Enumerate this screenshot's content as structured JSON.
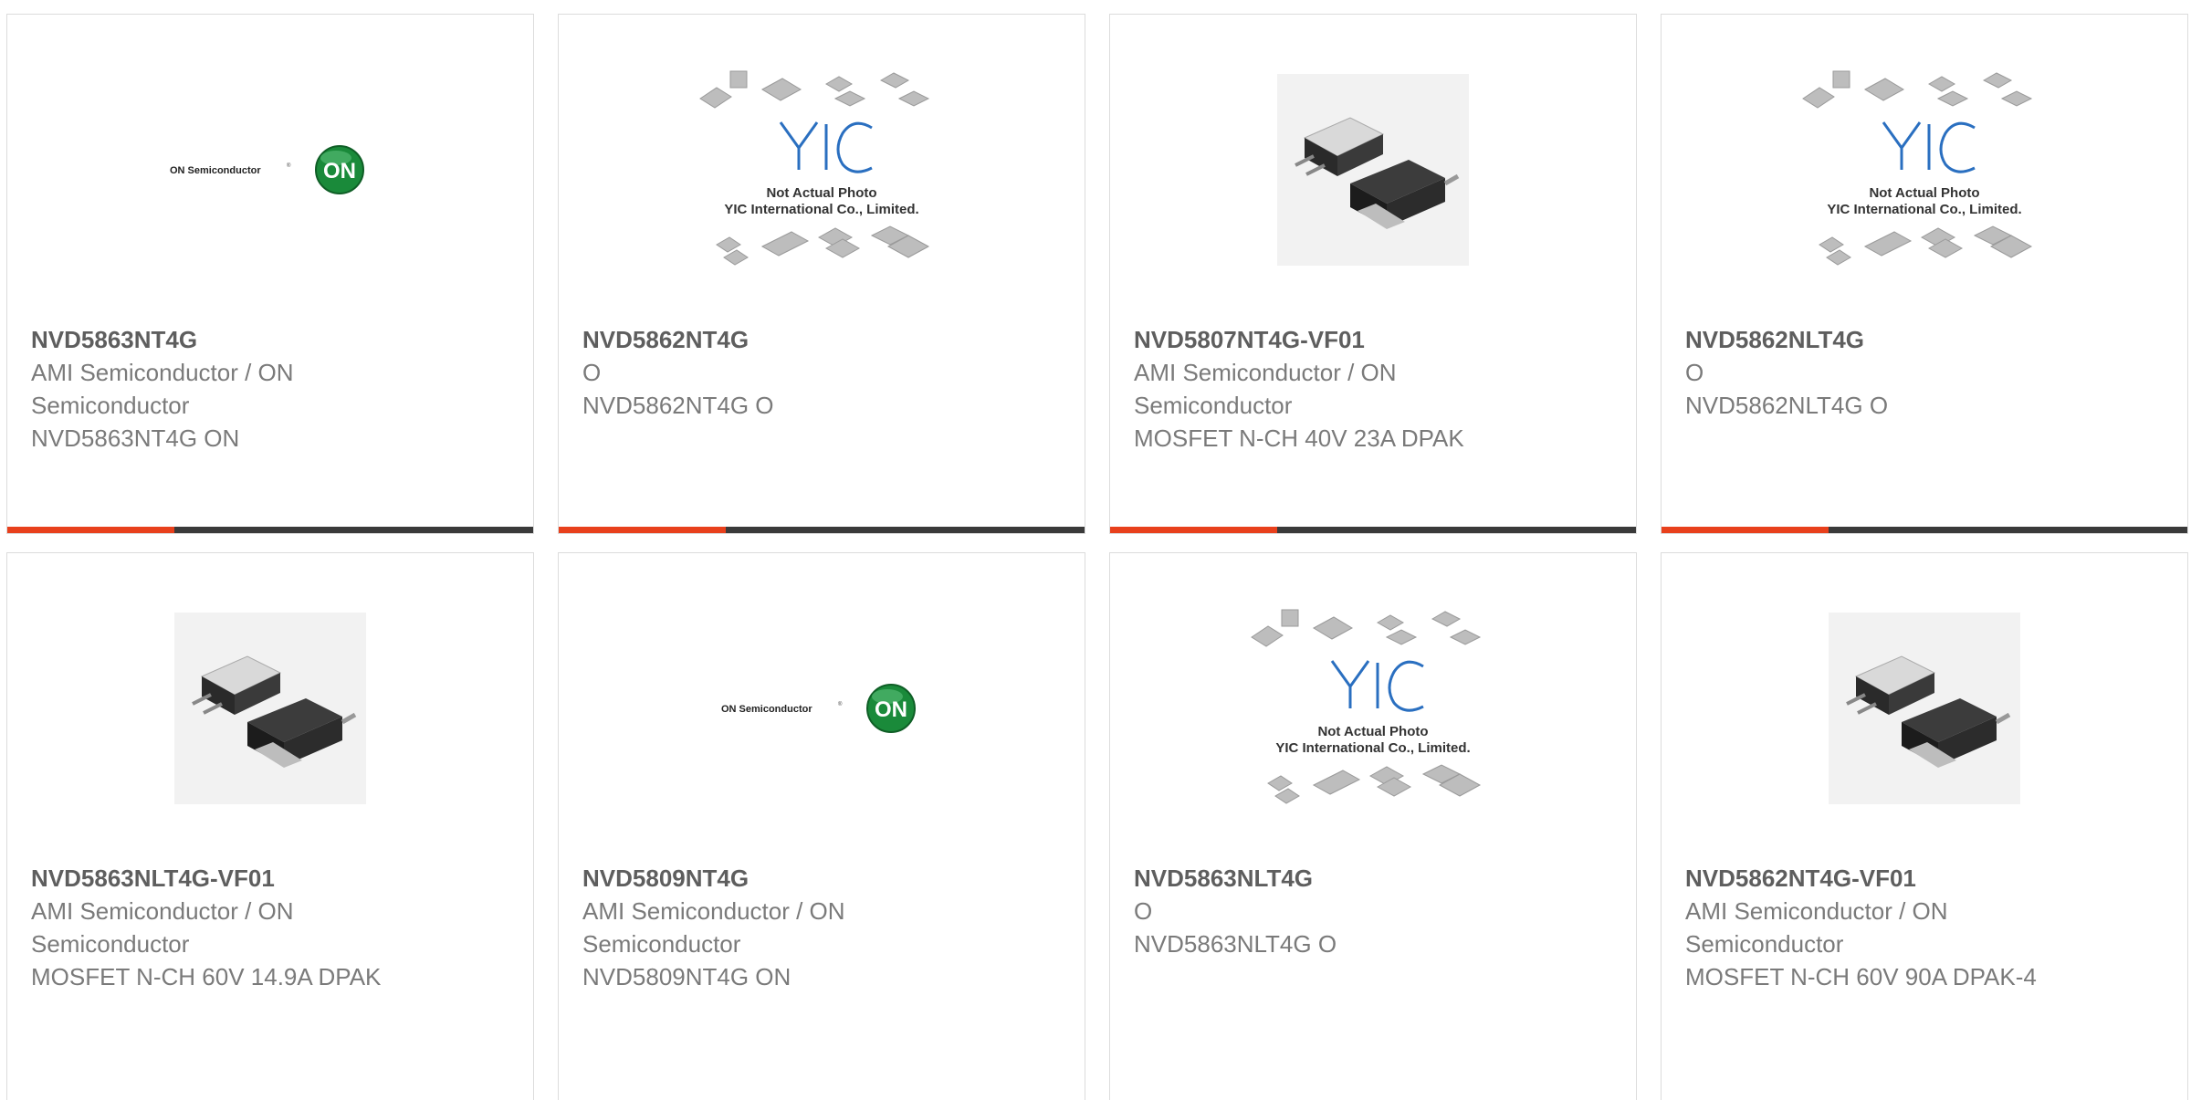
{
  "logos": {
    "on_semi_text": "ON Semiconductor",
    "on_badge": "ON",
    "yic_text": "YIC",
    "yic_caption_1": "Not Actual Photo",
    "yic_caption_2": "YIC International Co., Limited."
  },
  "colors": {
    "accent": "#e8401c",
    "bar_dark": "#3a3a3a",
    "on_green": "#1a8a3a",
    "yic_blue": "#2a6fc0"
  },
  "products": [
    {
      "part": "NVD5863NT4G",
      "manufacturer": "AMI Semiconductor / ON Semiconductor",
      "description": "NVD5863NT4G ON",
      "image": "on-semiconductor-logo"
    },
    {
      "part": "NVD5862NT4G",
      "manufacturer": "O",
      "description": "NVD5862NT4G O",
      "image": "yic-placeholder"
    },
    {
      "part": "NVD5807NT4G-VF01",
      "manufacturer": "AMI Semiconductor / ON Semiconductor",
      "description": "MOSFET N-CH 40V 23A DPAK",
      "image": "dpak-package"
    },
    {
      "part": "NVD5862NLT4G",
      "manufacturer": "O",
      "description": "NVD5862NLT4G O",
      "image": "yic-placeholder"
    },
    {
      "part": "NVD5863NLT4G-VF01",
      "manufacturer": "AMI Semiconductor / ON Semiconductor",
      "description": "MOSFET N-CH 60V 14.9A DPAK",
      "image": "dpak-package"
    },
    {
      "part": "NVD5809NT4G",
      "manufacturer": "AMI Semiconductor / ON Semiconductor",
      "description": "NVD5809NT4G ON",
      "image": "on-semiconductor-logo"
    },
    {
      "part": "NVD5863NLT4G",
      "manufacturer": "O",
      "description": "NVD5863NLT4G O",
      "image": "yic-placeholder"
    },
    {
      "part": "NVD5862NT4G-VF01",
      "manufacturer": "AMI Semiconductor / ON Semiconductor",
      "description": "MOSFET N-CH 60V 90A DPAK-4",
      "image": "dpak-package"
    }
  ]
}
